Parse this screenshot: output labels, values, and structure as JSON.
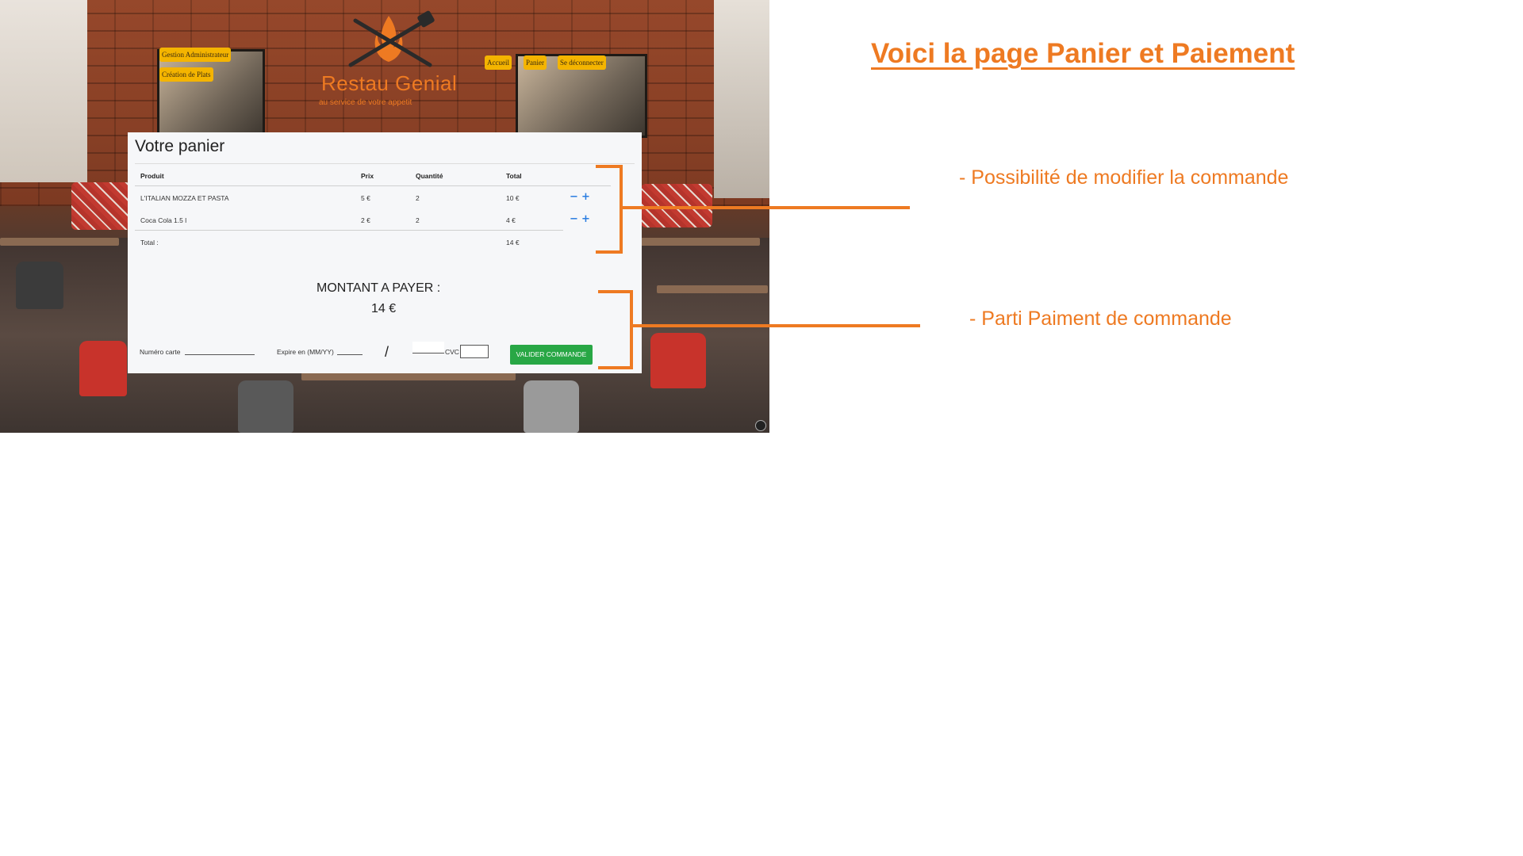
{
  "annotation": {
    "heading": "Voici la page Panier et Paiement",
    "notes": [
      "- Possibilité de modifier la commande",
      "- Parti Paiment de commande"
    ],
    "accent_color": "#ee7a22"
  },
  "site": {
    "logo_icon": "grill-fire-icon",
    "name": "Restau Genial",
    "tagline": "au service de votre appetit",
    "admin_nav": [
      "Gestion Administrateur",
      "Création de Plats"
    ],
    "main_nav": [
      "Accueil",
      "Panier",
      "Se déconnecter"
    ],
    "button_color": "#f4b400"
  },
  "cart": {
    "title": "Votre panier",
    "columns": [
      "Produit",
      "Prix",
      "Quantité",
      "Total"
    ],
    "rows": [
      {
        "product": "L'ITALIAN MOZZA ET PASTA",
        "price": "5 €",
        "qty": "2",
        "total": "10 €"
      },
      {
        "product": "Coca Cola 1.5 l",
        "price": "2 €",
        "qty": "2",
        "total": "4 €"
      }
    ],
    "total_label": "Total :",
    "total_value": "14 €",
    "minus_symbol": "−",
    "plus_symbol": "+"
  },
  "payment": {
    "amount_label": "MONTANT A PAYER :",
    "amount_value": "14 €",
    "card_label": "Numéro carte",
    "expiry_label": "Expire en (MM/YY)",
    "separator": "/",
    "cvc_label": "CVC",
    "submit_label": "VALIDER COMMANDE",
    "submit_color": "#28a745"
  }
}
